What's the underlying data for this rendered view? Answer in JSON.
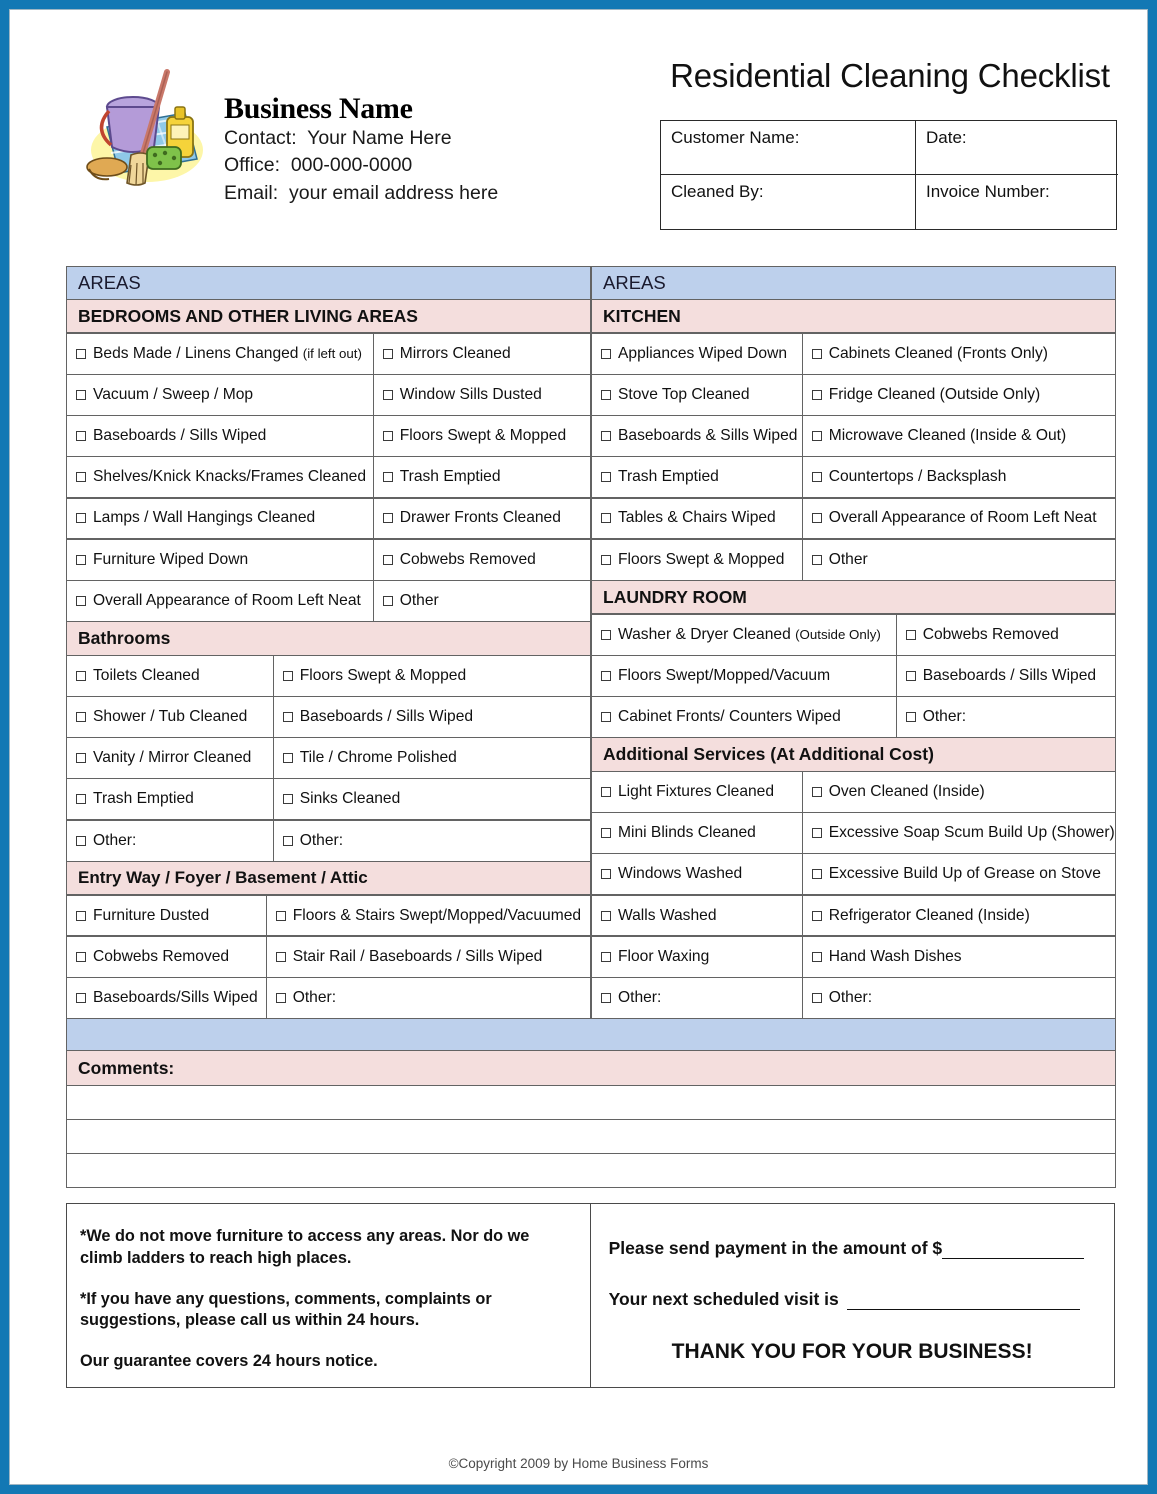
{
  "business": {
    "name": "Business Name",
    "contact": "Contact:  Your Name Here",
    "office": "Office:  000-000-0000",
    "email": "Email:  your email address here"
  },
  "title": "Residential Cleaning Checklist",
  "info": {
    "customer_name": "Customer Name:",
    "date": "Date:",
    "cleaned_by": "Cleaned By:",
    "invoice_number": "Invoice Number:"
  },
  "areas_header": "AREAS",
  "left": {
    "bedrooms": {
      "title": "BEDROOMS AND OTHER LIVING AREAS",
      "rows": [
        [
          "Beds Made / Linens Changed (if left out)",
          "Mirrors Cleaned"
        ],
        [
          "Vacuum / Sweep / Mop",
          "Window Sills Dusted"
        ],
        [
          "Baseboards / Sills Wiped",
          "Floors Swept & Mopped"
        ],
        [
          "Shelves/Knick Knacks/Frames Cleaned",
          "Trash Emptied"
        ],
        [
          "Lamps / Wall Hangings Cleaned",
          "Drawer Fronts Cleaned"
        ],
        [
          "Furniture Wiped Down",
          "Cobwebs Removed"
        ],
        [
          "Overall Appearance of Room Left Neat",
          "Other"
        ]
      ]
    },
    "bathrooms": {
      "title": "Bathrooms",
      "rows": [
        [
          "Toilets Cleaned",
          "Floors Swept & Mopped"
        ],
        [
          "Shower / Tub Cleaned",
          "Baseboards / Sills Wiped"
        ],
        [
          "Vanity / Mirror Cleaned",
          "Tile / Chrome Polished"
        ],
        [
          "Trash Emptied",
          "Sinks Cleaned"
        ],
        [
          "Other:",
          "Other:"
        ]
      ]
    },
    "entry": {
      "title": "Entry Way / Foyer / Basement / Attic",
      "rows": [
        [
          "Furniture Dusted",
          "Floors & Stairs Swept/Mopped/Vacuumed"
        ],
        [
          "Cobwebs Removed",
          "Stair Rail / Baseboards / Sills Wiped"
        ],
        [
          "Baseboards/Sills Wiped",
          "Other:"
        ]
      ]
    }
  },
  "right": {
    "kitchen": {
      "title": "KITCHEN",
      "rows": [
        [
          "Appliances Wiped Down",
          "Cabinets Cleaned (Fronts Only)"
        ],
        [
          "Stove Top Cleaned",
          "Fridge Cleaned (Outside Only)"
        ],
        [
          "Baseboards & Sills Wiped",
          "Microwave Cleaned (Inside & Out)"
        ],
        [
          "Trash Emptied",
          "Countertops / Backsplash"
        ],
        [
          "Tables & Chairs Wiped",
          "Overall Appearance of Room Left Neat"
        ],
        [
          "Floors Swept & Mopped",
          "Other"
        ]
      ]
    },
    "laundry": {
      "title": "LAUNDRY ROOM",
      "rows": [
        [
          "Washer & Dryer Cleaned (Outside Only)",
          "Cobwebs Removed"
        ],
        [
          "Floors Swept/Mopped/Vacuum",
          "Baseboards / Sills Wiped"
        ],
        [
          "Cabinet Fronts/ Counters Wiped",
          "Other:"
        ]
      ]
    },
    "additional": {
      "title": "Additional Services (At Additional Cost)",
      "rows": [
        [
          "Light Fixtures Cleaned",
          "Oven Cleaned (Inside)"
        ],
        [
          "Mini Blinds Cleaned",
          "Excessive Soap Scum Build Up (Shower)"
        ],
        [
          "Windows Washed",
          "Excessive Build Up of Grease on Stove"
        ],
        [
          "Walls Washed",
          "Refrigerator Cleaned (Inside)"
        ],
        [
          "Floor Waxing",
          "Hand Wash Dishes"
        ],
        [
          "Other:",
          "Other:"
        ]
      ]
    }
  },
  "comments_label": "Comments:",
  "notes": [
    "*We do not move furniture to access any areas.  Nor do we climb ladders to reach high places.",
    "*If you have any questions, comments, complaints or suggestions, please call us within 24 hours.",
    "Our guarantee covers 24 hours notice."
  ],
  "payment": {
    "amount_label": "Please send payment in the amount of $",
    "visit_label": "Your next scheduled visit is",
    "thanks": "THANK YOU FOR YOUR BUSINESS!"
  },
  "copyright": "©Copyright 2009 by Home Business Forms"
}
